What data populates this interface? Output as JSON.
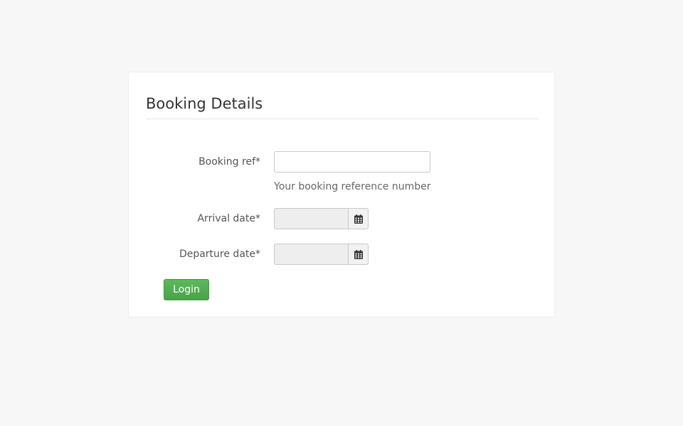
{
  "page": {
    "title": "Booking Details"
  },
  "form": {
    "booking_ref": {
      "label": "Booking ref*",
      "value": "",
      "placeholder": "",
      "help": "Your booking reference number"
    },
    "arrival_date": {
      "label": "Arrival date*",
      "value": "",
      "icon": "calendar-icon"
    },
    "departure_date": {
      "label": "Departure date*",
      "value": "",
      "icon": "calendar-icon"
    },
    "submit_label": "Login"
  },
  "colors": {
    "page_background": "#f7f7f7",
    "panel_background": "#ffffff",
    "login_button": "#5cb85c",
    "date_input_background": "#eeeeee"
  }
}
